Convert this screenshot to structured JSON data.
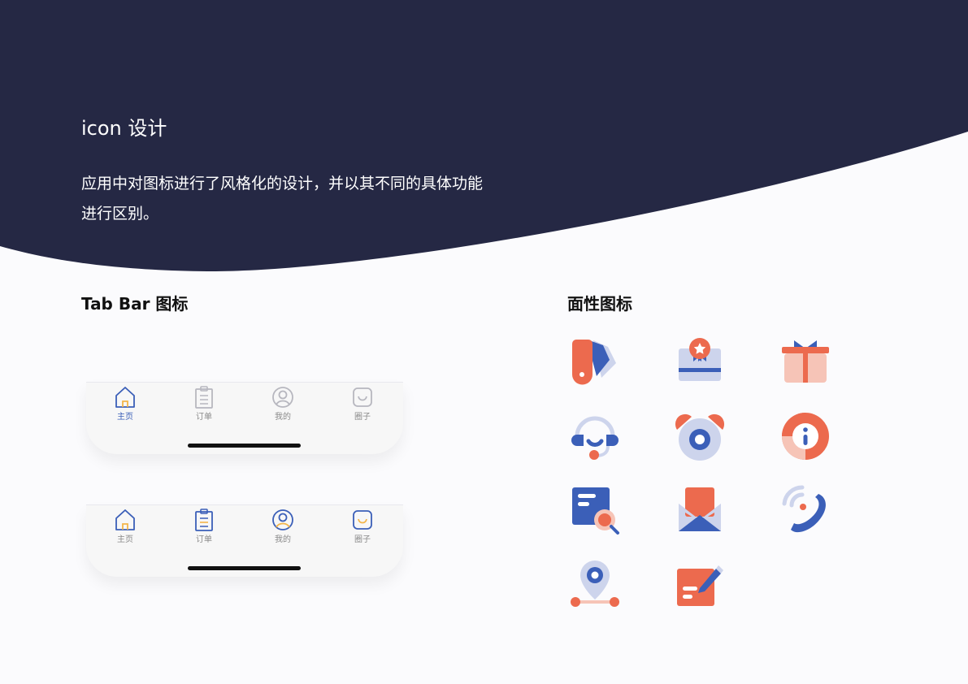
{
  "header": {
    "title": "icon 设计",
    "description": "应用中对图标进行了风格化的设计，并以其不同的具体功能进行区别。"
  },
  "tabbar_section": {
    "title": "Tab Bar 图标"
  },
  "face_section": {
    "title": "面性图标"
  },
  "tabbars": [
    {
      "state": "default",
      "items": [
        {
          "label": "主页",
          "icon": "home-icon",
          "active": true
        },
        {
          "label": "订单",
          "icon": "order-clipboard-icon",
          "active": false
        },
        {
          "label": "我的",
          "icon": "profile-icon",
          "active": false
        },
        {
          "label": "圈子",
          "icon": "community-smile-icon",
          "active": false
        }
      ]
    },
    {
      "state": "colored",
      "items": [
        {
          "label": "主页",
          "icon": "home-icon"
        },
        {
          "label": "订单",
          "icon": "order-clipboard-icon"
        },
        {
          "label": "我的",
          "icon": "profile-icon"
        },
        {
          "label": "圈子",
          "icon": "community-smile-icon"
        }
      ]
    }
  ],
  "face_icons": [
    "tag-icon",
    "certificate-icon",
    "gift-icon",
    "customer-service-icon",
    "alarm-clock-icon",
    "info-icon",
    "document-search-icon",
    "mail-icon",
    "phone-icon",
    "location-route-icon",
    "note-edit-icon"
  ],
  "colors": {
    "navy": "#252844",
    "background": "#fbfbfd",
    "blue": "#3b5fb8",
    "light_blue": "#cdd4ec",
    "orange": "#ec6a4e",
    "peach": "#f6c4b7",
    "yellow": "#f3b54a",
    "gray": "#b7b7bf"
  }
}
